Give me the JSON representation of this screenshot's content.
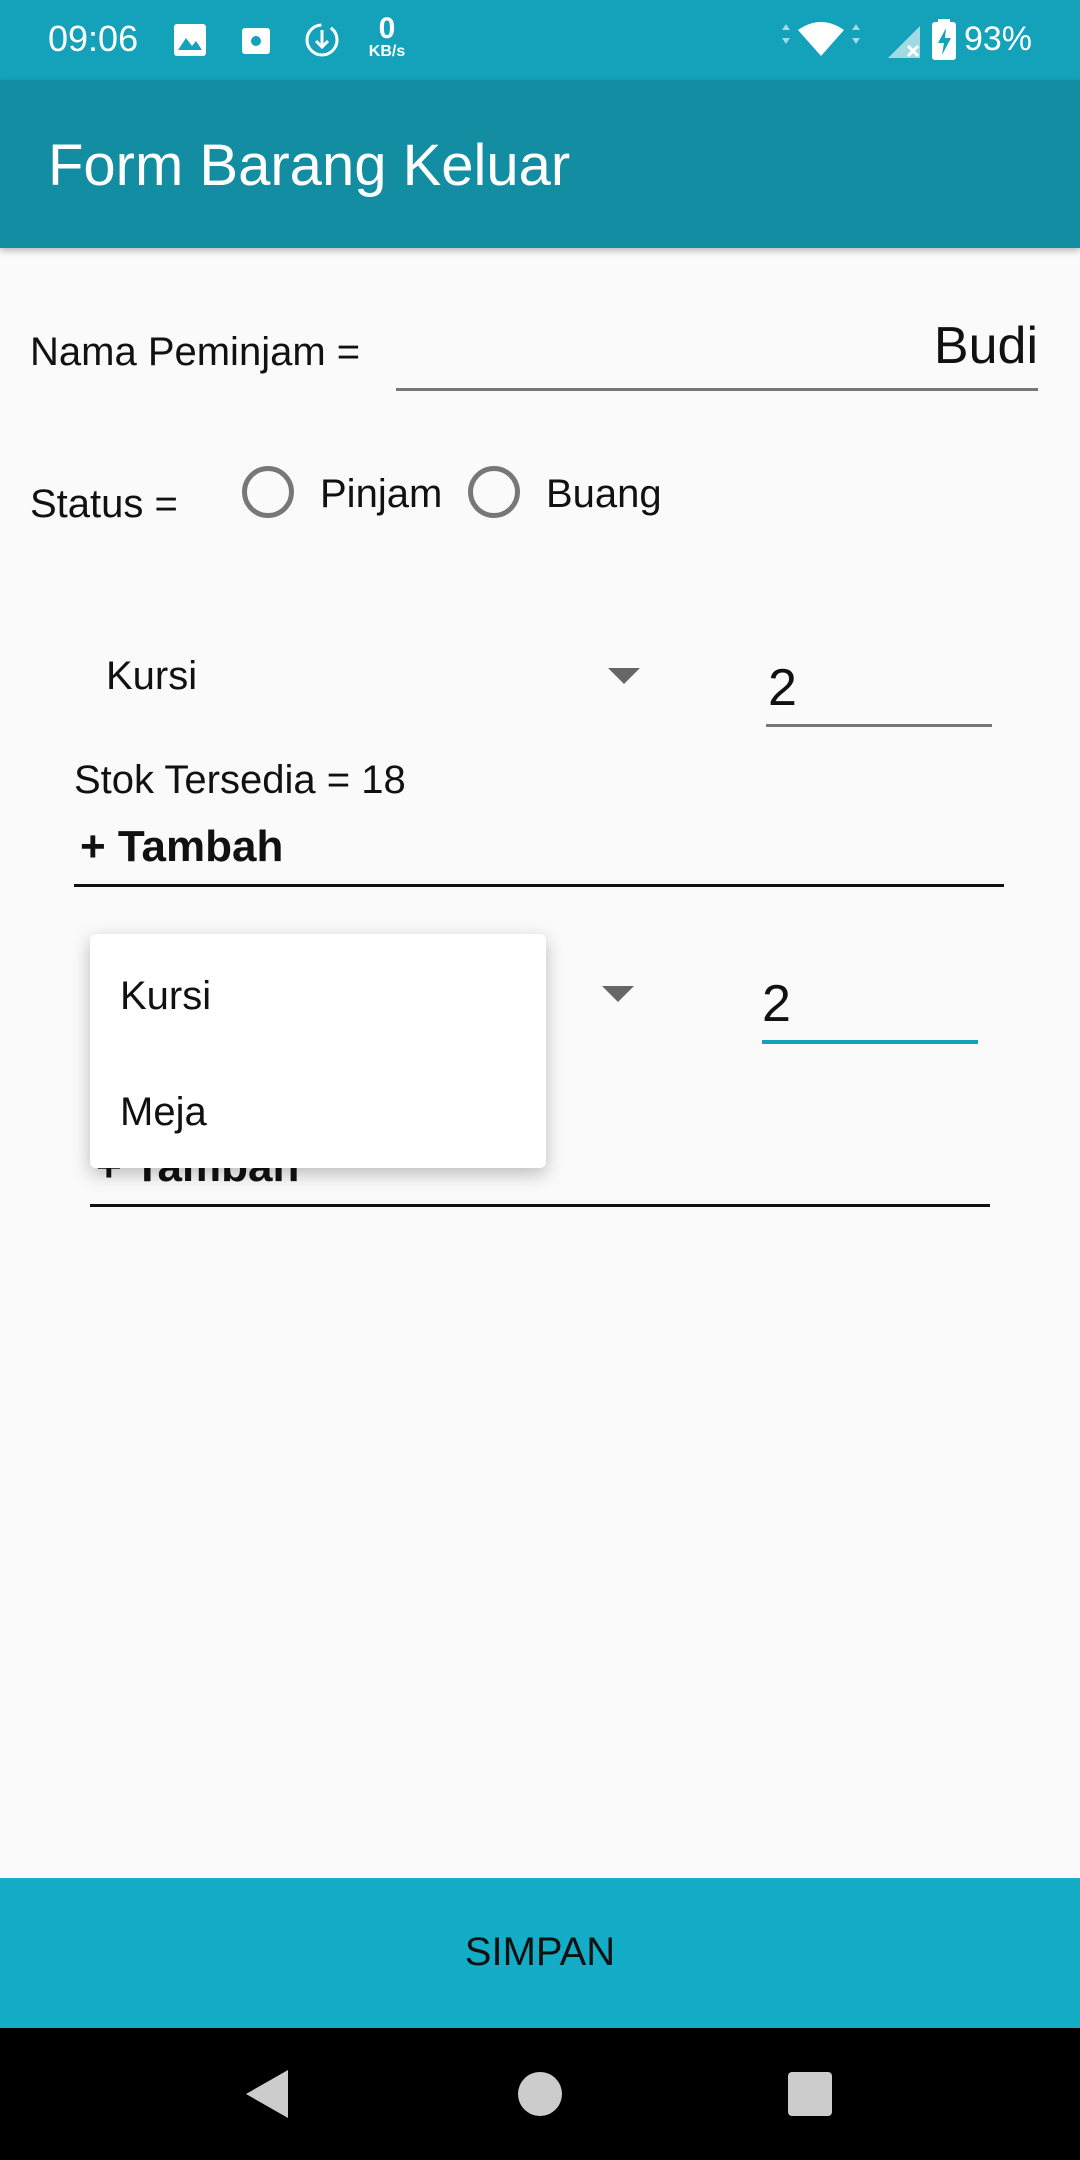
{
  "status_bar": {
    "time": "09:06",
    "network_rate_value": "0",
    "network_rate_unit": "KB/s",
    "battery": "93%"
  },
  "appbar": {
    "title": "Form Barang Keluar"
  },
  "form": {
    "borrower_label": "Nama Peminjam =",
    "borrower_value": "Budi",
    "status_label": "Status =",
    "status_options": [
      "Pinjam",
      "Buang"
    ]
  },
  "item1": {
    "item": "Kursi",
    "qty": "2",
    "stock": "Stok Tersedia = 18",
    "add_label": "+ Tambah"
  },
  "item2": {
    "qty": "2",
    "add_label": "+ Tambah"
  },
  "dropdown": {
    "options": [
      "Kursi",
      "Meja"
    ]
  },
  "footer": {
    "save_label": "SIMPAN"
  },
  "colors": {
    "statusbar": "#14a2bb",
    "appbar": "#138da2",
    "save": "#14adc8",
    "accent": "#14a2bb"
  }
}
